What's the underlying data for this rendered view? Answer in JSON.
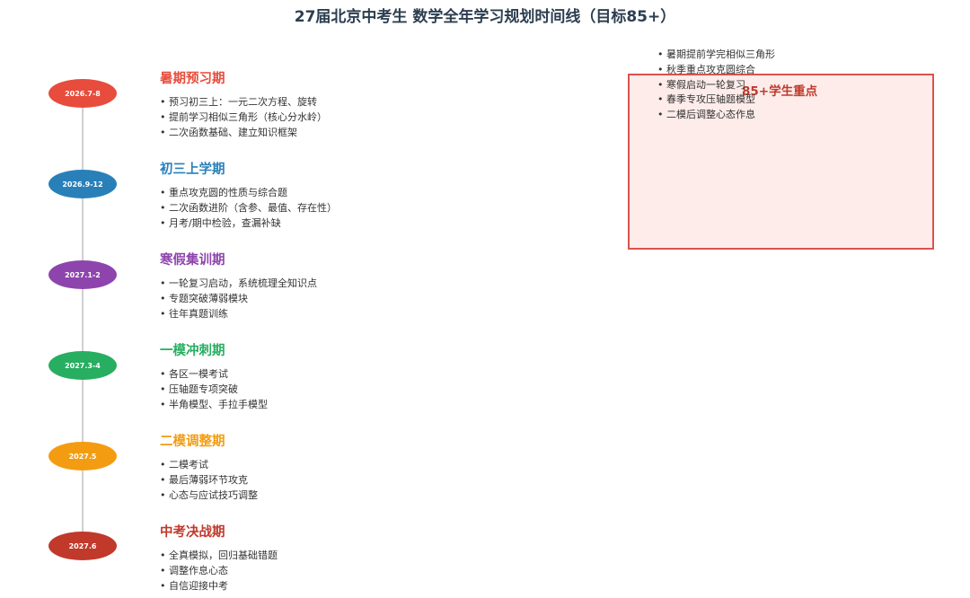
{
  "title": "27届北京中考生 数学全年学习规划时间线（目标85+）",
  "phases": [
    {
      "date": "2026.7-8",
      "title": "暑期预习期",
      "color": "#e74c3c",
      "items": [
        "预习初三上：一元二次方程、旋转",
        "提前学习相似三角形（核心分水岭）",
        "二次函数基础、建立知识框架"
      ]
    },
    {
      "date": "2026.9-12",
      "title": "初三上学期",
      "color": "#2980b9",
      "items": [
        "重点攻克圆的性质与综合题",
        "二次函数进阶（含参、最值、存在性）",
        "月考/期中检验，查漏补缺"
      ]
    },
    {
      "date": "2027.1-2",
      "title": "寒假集训期",
      "color": "#8e44ad",
      "items": [
        "一轮复习启动，系统梳理全知识点",
        "专题突破薄弱模块",
        "往年真题训练"
      ]
    },
    {
      "date": "2027.3-4",
      "title": "一模冲刺期",
      "color": "#27ae60",
      "items": [
        "各区一模考试",
        "压轴题专项突破",
        "半角模型、手拉手模型"
      ]
    },
    {
      "date": "2027.5",
      "title": "二模调整期",
      "color": "#f39c12",
      "items": [
        "二模考试",
        "最后薄弱环节攻克",
        "心态与应试技巧调整"
      ]
    },
    {
      "date": "2027.6",
      "title": "中考决战期",
      "color": "#c0392b",
      "items": [
        "全真模拟，回归基础错题",
        "调整作息心态",
        "自信迎接中考"
      ]
    }
  ],
  "focus": {
    "title": "85+学生重点",
    "items": [
      "暑期提前学完相似三角形",
      "秋季重点攻克圆综合",
      "寒假启动一轮复习",
      "春季专攻压轴题模型",
      "二模后调整心态作息"
    ]
  }
}
